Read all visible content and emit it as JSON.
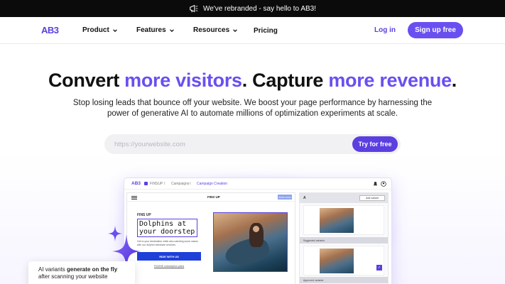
{
  "announcement": {
    "text": "We've rebranded - say hello to AB3!",
    "icon": "megaphone-icon"
  },
  "nav": {
    "logo": "AB3",
    "items": [
      {
        "label": "Product",
        "has_dropdown": true
      },
      {
        "label": "Features",
        "has_dropdown": true
      },
      {
        "label": "Resources",
        "has_dropdown": true
      },
      {
        "label": "Pricing",
        "has_dropdown": false
      }
    ],
    "login": "Log in",
    "signup": "Sign up free"
  },
  "hero": {
    "headline_part1": "Convert ",
    "headline_accent1": "more visitors",
    "headline_part2": ". Capture ",
    "headline_accent2": "more revenue",
    "headline_part3": ".",
    "subtitle": "Stop losing leads that bounce off your website. We boost your page performance by harnessing the power of generative AI to automate millions of optimization experiments at scale.",
    "search_placeholder": "https://yourwebsite.com",
    "try_button": "Try for free"
  },
  "mockup": {
    "logo": "AB3",
    "crumbs": [
      "FINSUP",
      "/",
      "Campaigns",
      "/",
      "Campaign Creation"
    ],
    "page": {
      "brand": "FINS UP",
      "book_button": "BOOK NOW",
      "eyebrow": "FINS UP",
      "title": "Dolphins at your doorstep",
      "description": "Get to your destination while also catching some waves with our dolphin rideshare services.",
      "cta": "RIDE WITH US",
      "link": "FINONE subscription plans"
    },
    "variants": {
      "header": "A",
      "add_button": "Add variant",
      "suggested_label": "Suggested variants",
      "approved_label": "Approved variants"
    }
  },
  "tooltip": {
    "text_before": "AI variants ",
    "text_bold": "generate on the fly",
    "text_after": " after scanning your website"
  },
  "colors": {
    "brand": "#6a4ff0",
    "brand_dark": "#5b3fe0",
    "announce_bg": "#0b0b0b"
  }
}
